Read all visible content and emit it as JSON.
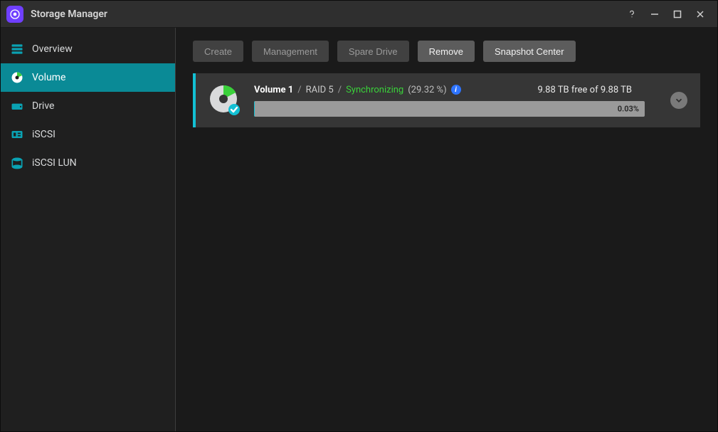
{
  "window": {
    "title": "Storage Manager"
  },
  "sidebar": {
    "items": [
      {
        "label": "Overview",
        "icon": "stack"
      },
      {
        "label": "Volume",
        "icon": "volume"
      },
      {
        "label": "Drive",
        "icon": "drive"
      },
      {
        "label": "iSCSI",
        "icon": "iscsi"
      },
      {
        "label": "iSCSI LUN",
        "icon": "lun"
      }
    ],
    "active_index": 1
  },
  "toolbar": {
    "buttons": [
      {
        "label": "Create",
        "enabled": false
      },
      {
        "label": "Management",
        "enabled": false
      },
      {
        "label": "Spare Drive",
        "enabled": false
      },
      {
        "label": "Remove",
        "enabled": true
      },
      {
        "label": "Snapshot Center",
        "enabled": true
      }
    ]
  },
  "volume": {
    "name": "Volume 1",
    "raid": "RAID 5",
    "status": "Synchronizing",
    "sync_percent": "(29.32 %)",
    "free_text": "9.88 TB free of 9.88 TB",
    "usage_percent_label": "0.03%",
    "usage_percent_value": 0.03
  },
  "colors": {
    "accent": "#12c0d4",
    "status_ok": "#3ad13a",
    "info": "#2e74ff"
  }
}
